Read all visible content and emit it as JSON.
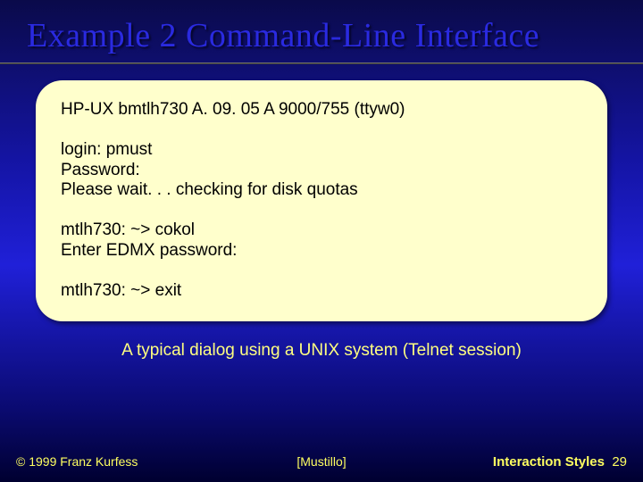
{
  "title": "Example 2 Command-Line Interface",
  "terminal": {
    "line1": "HP-UX bmtlh730 A. 09. 05 A 9000/755 (ttyw0)",
    "line2": "login: pmust",
    "line3": "Password:",
    "line4": "Please wait. . . checking for disk quotas",
    "line5": "mtlh730: ~> cokol",
    "line6": "Enter EDMX password:",
    "line7": "mtlh730: ~> exit"
  },
  "caption": "A typical dialog using a UNIX system (Telnet session)",
  "footer": {
    "copyright": "© 1999 Franz Kurfess",
    "source": "[Mustillo]",
    "section": "Interaction Styles",
    "page": "29"
  }
}
